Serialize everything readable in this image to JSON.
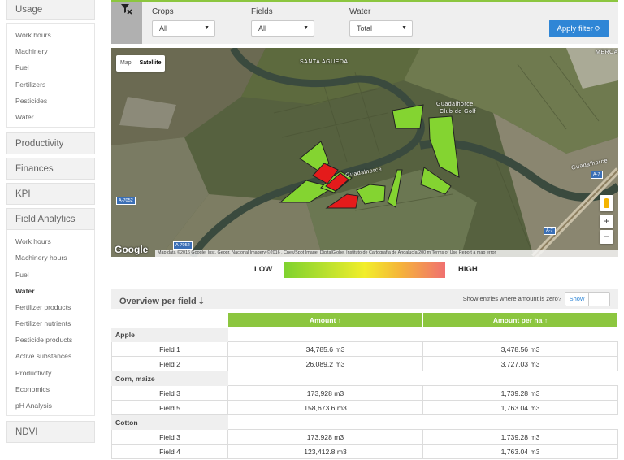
{
  "sidebar": {
    "sections": [
      {
        "label": "Usage",
        "items": [
          "Work hours",
          "Machinery",
          "Fuel",
          "Fertilizers",
          "Pesticides",
          "Water"
        ]
      },
      {
        "label": "Productivity"
      },
      {
        "label": "Finances"
      },
      {
        "label": "KPI"
      },
      {
        "label": "Field Analytics",
        "items": [
          "Work hours",
          "Machinery hours",
          "Fuel",
          "Water",
          "Fertilizer products",
          "Fertilizer nutrients",
          "Pesticide products",
          "Active substances",
          "Productivity",
          "Economics",
          "pH Analysis"
        ],
        "active_item": "Water"
      },
      {
        "label": "NDVI"
      }
    ]
  },
  "filters": {
    "crops": {
      "label": "Crops",
      "value": "All"
    },
    "fields": {
      "label": "Fields",
      "value": "All"
    },
    "water": {
      "label": "Water",
      "value": "Total"
    },
    "apply_label": "Apply filter",
    "icon": "filter-clear-icon"
  },
  "map": {
    "tab_map": "Map",
    "tab_satellite": "Satellite",
    "zoom_in": "+",
    "zoom_out": "−",
    "google": "Google",
    "attribution": "Map data ©2016 Google, Inst. Geogr. Nacional Imagery ©2016 , Cnes/Spot Image, DigitalGlobe, Instituto de Cartografía de Andalucía   200 m          Terms of Use   Report a map error",
    "labels": {
      "santa_agueda": "SANTA AGUEDA",
      "guadalhorce_river": "Guadalhorce",
      "guadalhorce_club": "Guadalhorce",
      "club_de_golf": "Club de Golf",
      "guadalhorce_right": "Guadalhorce",
      "merca": "MERCA"
    },
    "roads": [
      "A-7052",
      "A-7052",
      "A-7",
      "A-7"
    ],
    "colors": {
      "low": "#7fd22f",
      "high": "#e02020"
    }
  },
  "legend": {
    "low": "LOW",
    "high": "HIGH"
  },
  "overview": {
    "title": "Overview per field",
    "zero_label": "Show entries where amount is zero?",
    "toggle": "Show"
  },
  "table": {
    "headers": {
      "amount": "Amount ↑",
      "amount_per_ha": "Amount per ha ↑"
    },
    "groups": [
      {
        "crop": "Apple",
        "rows": [
          {
            "field": "Field 1",
            "amount": "34,785.6 m3",
            "per_ha": "3,478.56 m3"
          },
          {
            "field": "Field 2",
            "amount": "26,089.2 m3",
            "per_ha": "3,727.03 m3"
          }
        ]
      },
      {
        "crop": "Corn, maize",
        "rows": [
          {
            "field": "Field 3",
            "amount": "173,928 m3",
            "per_ha": "1,739.28 m3"
          },
          {
            "field": "Field 5",
            "amount": "158,673.6 m3",
            "per_ha": "1,763.04 m3"
          }
        ]
      },
      {
        "crop": "Cotton",
        "rows": [
          {
            "field": "Field 3",
            "amount": "173,928 m3",
            "per_ha": "1,739.28 m3"
          },
          {
            "field": "Field 4",
            "amount": "123,412.8 m3",
            "per_ha": "1,763.04 m3"
          }
        ]
      }
    ]
  }
}
